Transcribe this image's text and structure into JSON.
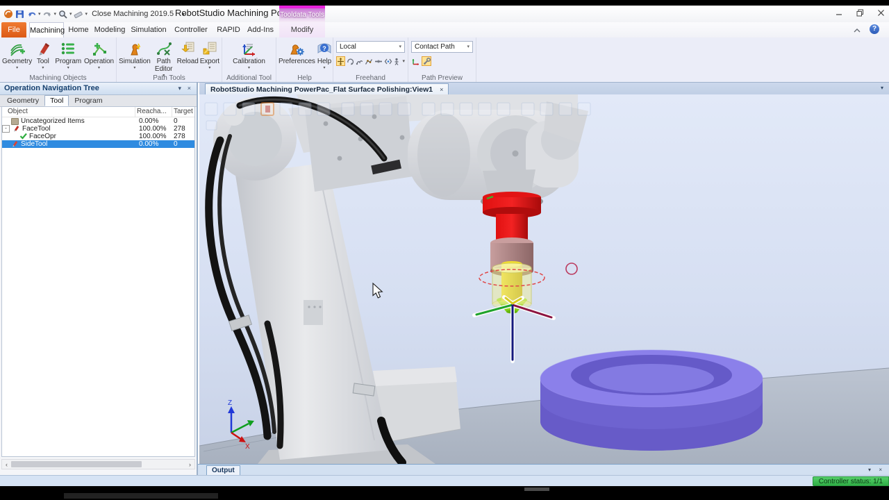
{
  "titlebar": {
    "qat_label": "Close Machining 2019.5",
    "title": "RobotStudio Machining Pow...",
    "contextual_group": "Tooldata Tools"
  },
  "tabs": {
    "file": "File",
    "machining": "Machining",
    "home": "Home",
    "modeling": "Modeling",
    "simulation": "Simulation",
    "controller": "Controller",
    "rapid": "RAPID",
    "addins": "Add-Ins",
    "modify": "Modify"
  },
  "ribbon": {
    "machining_objects": {
      "label": "Machining Objects",
      "geometry": "Geometry",
      "tool": "Tool",
      "program": "Program",
      "operation": "Operation"
    },
    "path_tools": {
      "label": "Path Tools",
      "simulation": "Simulation",
      "path_editor": "Path Editor",
      "reload": "Reload",
      "export": "Export"
    },
    "additional_tool": {
      "label": "Additional Tool",
      "calibration": "Calibration"
    },
    "help": {
      "label": "Help",
      "preferences": "Preferences",
      "help": "Help"
    },
    "freehand": {
      "label": "Freehand",
      "mode": "Local"
    },
    "path_preview": {
      "label": "Path Preview",
      "mode": "Contact Path"
    }
  },
  "left_panel": {
    "title": "Operation Navigation Tree",
    "tabs": {
      "geometry": "Geometry",
      "tool": "Tool",
      "program": "Program"
    },
    "columns": {
      "object": "Object",
      "reachability": "Reacha...",
      "target": "Target"
    },
    "rows": [
      {
        "name": "Uncategorized Items",
        "reachability": "0.00%",
        "targets": "0"
      },
      {
        "name": "FaceTool",
        "reachability": "100.00%",
        "targets": "278"
      },
      {
        "name": "FaceOpr",
        "reachability": "100.00%",
        "targets": "278"
      },
      {
        "name": "SideTool",
        "reachability": "0.00%",
        "targets": "0"
      }
    ],
    "selected_row": "SideTool"
  },
  "viewport": {
    "tab_title": "RobotStudio Machining PowerPac_Flat Surface Polishing:View1",
    "axes": {
      "z": "Z",
      "x": "X"
    }
  },
  "output": {
    "label": "Output"
  },
  "statusbar": {
    "controller_status": "Controller status: 1/1"
  },
  "glyphs": {
    "dropdown": "▾",
    "close": "×",
    "left": "‹",
    "right": "›",
    "minus": "-",
    "help": "?"
  },
  "colors": {
    "selection_blue": "#2f8be0",
    "file_tab_orange": "#dc5a15",
    "contextual_magenta": "#e821dc",
    "status_green": "#3fbf53",
    "workpiece_purple": "#8b80ea",
    "tool_red": "#d21313",
    "viewport_bg": "#d9e2f4"
  }
}
